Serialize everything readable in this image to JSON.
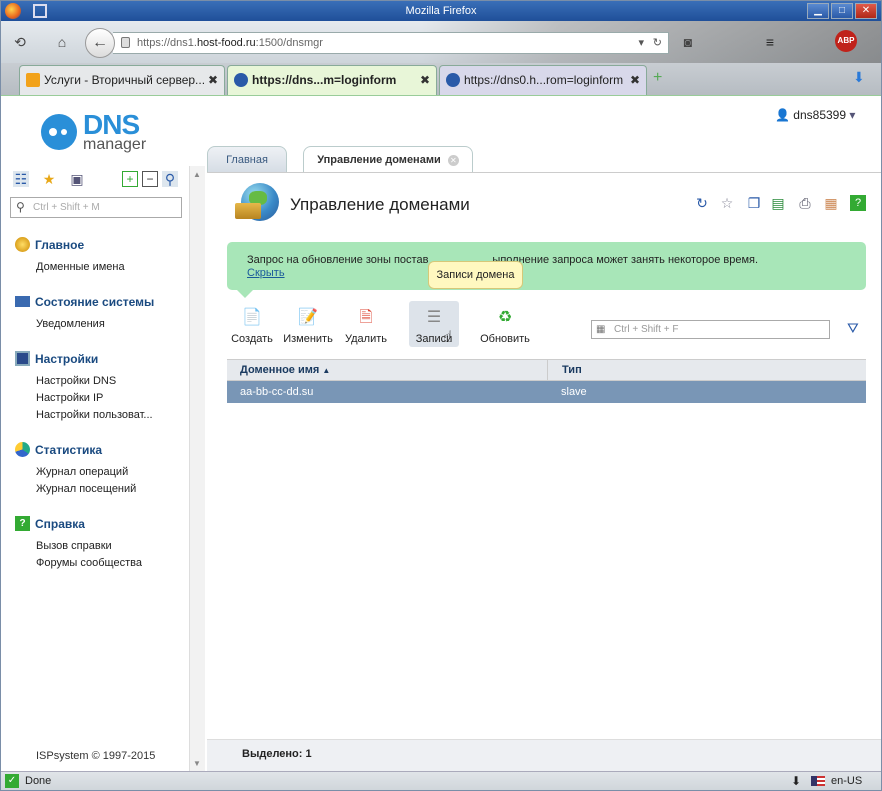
{
  "browser": {
    "window_title": "Mozilla Firefox",
    "url_prefix": "https://dns1.",
    "url_host": "host-food.ru",
    "url_suffix": ":1500/dnsmgr",
    "tabs": [
      {
        "label": "Услуги - Вторичный сервер...",
        "close": "✖"
      },
      {
        "label": "https://dns...m=loginform",
        "close": "✖"
      },
      {
        "label": "https://dns0.h...rom=loginform",
        "close": "✖"
      }
    ],
    "status_text": "Done",
    "locale": "en-US"
  },
  "header": {
    "logo_main": "DNS",
    "logo_sub": "manager",
    "username": "dns85399"
  },
  "sidebar": {
    "search_placeholder": "Ctrl + Shift + M",
    "groups": [
      {
        "label": "Главное",
        "items": [
          "Доменные имена"
        ]
      },
      {
        "label": "Состояние системы",
        "items": [
          "Уведомления"
        ]
      },
      {
        "label": "Настройки",
        "items": [
          "Настройки DNS",
          "Настройки IP",
          "Настройки пользоват..."
        ]
      },
      {
        "label": "Статистика",
        "items": [
          "Журнал операций",
          "Журнал посещений"
        ]
      },
      {
        "label": "Справка",
        "items": [
          "Вызов справки",
          "Форумы сообщества"
        ]
      }
    ],
    "copyright": "ISPsystem © 1997-2015"
  },
  "main": {
    "tabs": [
      {
        "label": "Главная"
      },
      {
        "label": "Управление доменами"
      }
    ],
    "page_title": "Управление доменами",
    "notice_text_a": "Запрос на обновление зоны постав",
    "notice_text_b": "ыполнение запроса может занять некоторое время.",
    "notice_hide": "Скрыть",
    "tooltip": "Записи домена",
    "toolbar": {
      "create": "Создать",
      "edit": "Изменить",
      "delete": "Удалить",
      "records": "Записи",
      "refresh": "Обновить"
    },
    "search_placeholder": "Ctrl + Shift + F",
    "table": {
      "columns": [
        "Доменное имя",
        "Тип"
      ],
      "rows": [
        {
          "domain": "aa-bb-cc-dd.su",
          "type": "slave"
        }
      ]
    },
    "footer_selected": "Выделено: 1"
  }
}
